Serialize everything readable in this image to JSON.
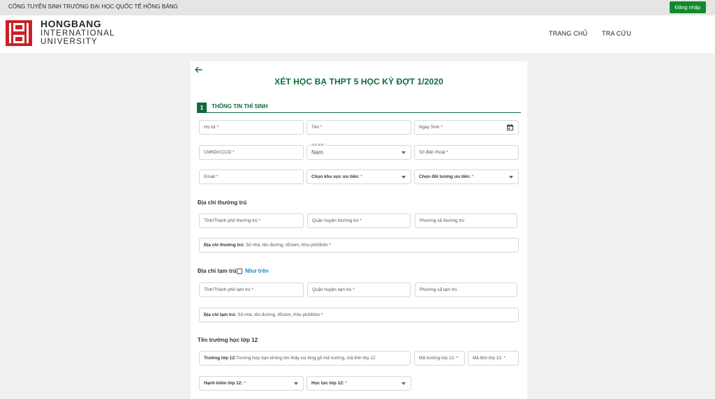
{
  "topbar": {
    "title": "CỔNG TUYỂN SINH TRƯỜNG ĐẠI HỌC QUỐC TẾ HỒNG BÀNG",
    "login_label": "Đăng nhập"
  },
  "header": {
    "logo": {
      "line1": "HONGBANG",
      "line2": "INTERNATIONAL",
      "line3": "UNIVERSITY"
    },
    "nav": [
      "TRANG CHỦ",
      "TRA CỨU"
    ]
  },
  "colors": {
    "brand_green": "#106b3a",
    "button_green": "#118a2f",
    "logo_red": "#cc1f26",
    "link_blue": "#1e88c8"
  },
  "form": {
    "title": "XÉT HỌC BẠ THPT 5 HỌC KỲ ĐỢT 1/2020",
    "section": {
      "number": "1",
      "label": "THÔNG TIN THÍ SINH"
    },
    "personal": {
      "ho_lot": "Họ lót",
      "ten": "Tên",
      "ngay_sinh": "Ngày Sinh",
      "cmnd": "CMND/CCCD",
      "gioi_tinh_label": "Giới tính",
      "gioi_tinh_value": "Nam",
      "so_dien_thoai": "Số điện thoại",
      "email": "Email",
      "khu_vuc": "Chọn khu vực ưu tiên:",
      "doi_tuong": "Chọn đối tượng ưu tiên:"
    },
    "thuong_tru": {
      "heading": "Địa chỉ thường trú",
      "tinh": "Tỉnh/Thành phố thường trú",
      "quan": "Quận huyện thường trú",
      "phuong": "Phường xã thường trú",
      "dia_chi_bold": "Địa chỉ thường trú:",
      "dia_chi_hint": " Số nhà, tên đường, tổ/xóm, Khu phố/thôn"
    },
    "tam_tru": {
      "heading": "Địa chỉ tạm trú",
      "same_label": "Như trên",
      "tinh": "Tỉnh/Thành phố tạm trú",
      "quan": "Quận huyện tạm trú",
      "phuong": "Phường xã tạm trú",
      "dia_chi_bold": "Địa chỉ tạm trú:",
      "dia_chi_hint": " Số nhà, tên đường, tổ/xóm, Khu phố/thôn"
    },
    "truong": {
      "heading": "Tên trường học lớp 12",
      "truong_bold": "Trường lớp 12:",
      "truong_hint": "Trường hợp bạn không tìm thấy vui lòng gõ mã trường, mã tỉnh lớp 12",
      "ma_truong": "Mã trường lớp 12:",
      "ma_tinh": "Mã tỉnh lớp 12:",
      "hanh_kiem": "Hạnh kiểm lớp 12:",
      "hoc_luc": "Học lực lớp 12:"
    }
  }
}
